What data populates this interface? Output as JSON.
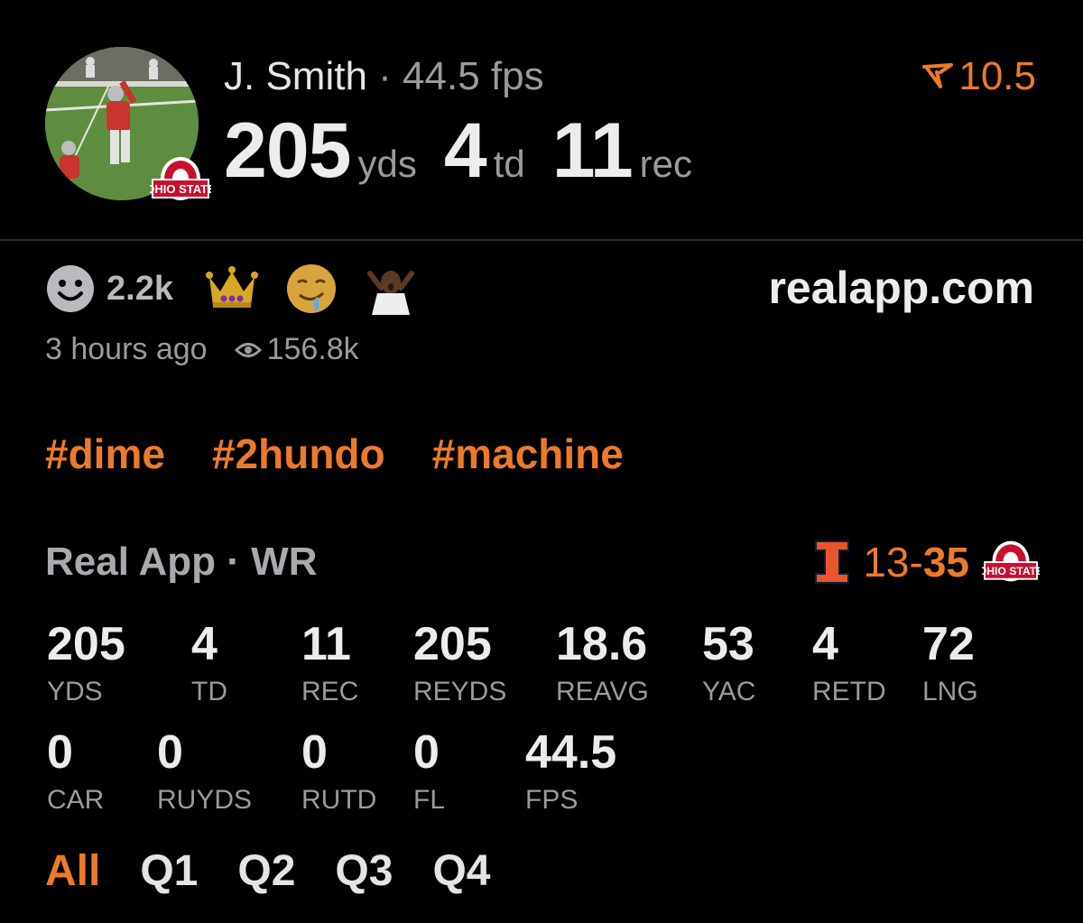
{
  "header": {
    "player_name": "J. Smith",
    "separator": "·",
    "fps_label": "44.5 fps",
    "boost_value": "10.5",
    "big_stats": [
      {
        "value": "205",
        "unit": "yds"
      },
      {
        "value": "4",
        "unit": "td"
      },
      {
        "value": "11",
        "unit": "rec"
      }
    ],
    "team_logo_text": "OHIO STATE"
  },
  "reactions": {
    "count": "2.2k",
    "icons": [
      "smiley-icon",
      "crown-icon",
      "drooling-emoji",
      "shocked-person-emoji"
    ]
  },
  "site": "realapp.com",
  "meta": {
    "time_ago": "3 hours ago",
    "views": "156.8k"
  },
  "tags": [
    "#dime",
    "#2hundo",
    "#machine"
  ],
  "game": {
    "label": "Real App · WR",
    "away_logo": "I",
    "score_away": "13-",
    "score_home": "35",
    "home_logo_text": "OHIO STATE"
  },
  "stat_rows": [
    [
      {
        "value": "205",
        "label": "YDS"
      },
      {
        "value": "4",
        "label": "TD"
      },
      {
        "value": "11",
        "label": "REC"
      },
      {
        "value": "205",
        "label": "REYDS"
      },
      {
        "value": "18.6",
        "label": "REAVG"
      },
      {
        "value": "53",
        "label": "YAC"
      },
      {
        "value": "4",
        "label": "RETD"
      },
      {
        "value": "72",
        "label": "LNG"
      }
    ],
    [
      {
        "value": "0",
        "label": "CAR"
      },
      {
        "value": "0",
        "label": "RUYDS"
      },
      {
        "value": "0",
        "label": "RUTD"
      },
      {
        "value": "0",
        "label": "FL"
      },
      {
        "value": "44.5",
        "label": "FPS"
      }
    ]
  ],
  "periods": [
    {
      "label": "All",
      "active": true
    },
    {
      "label": "Q1",
      "active": false
    },
    {
      "label": "Q2",
      "active": false
    },
    {
      "label": "Q3",
      "active": false
    },
    {
      "label": "Q4",
      "active": false
    }
  ],
  "colors": {
    "accent": "#ec7a2b",
    "background": "#000000",
    "muted": "#9a9a9f"
  }
}
